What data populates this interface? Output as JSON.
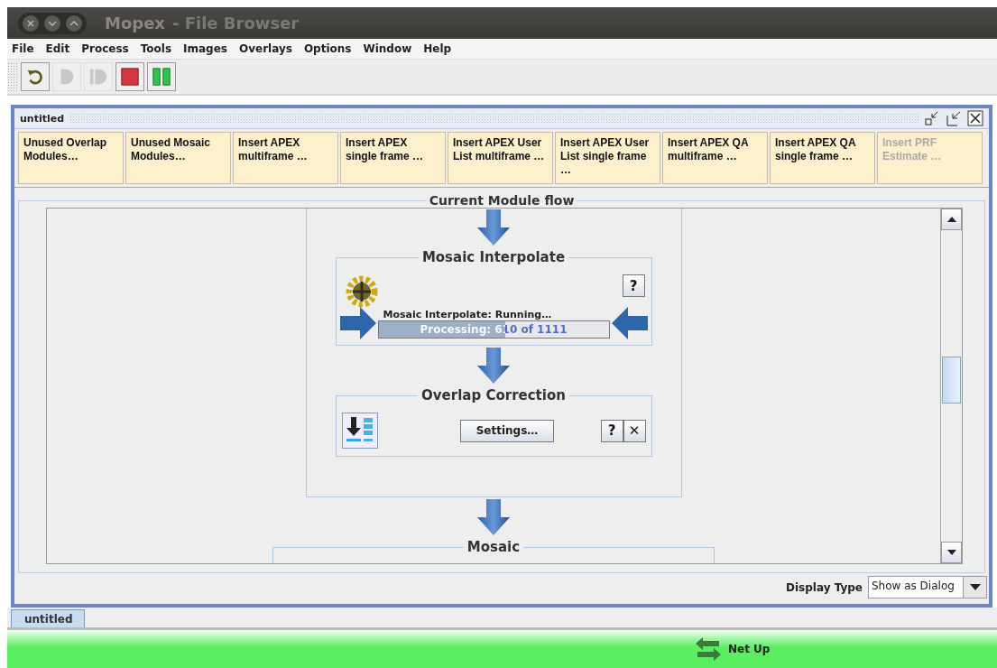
{
  "window": {
    "title": "Mopex",
    "subtitle": "- File Browser"
  },
  "menu": [
    {
      "label": "File"
    },
    {
      "label": "Edit"
    },
    {
      "label": "Process"
    },
    {
      "label": "Tools"
    },
    {
      "label": "Images"
    },
    {
      "label": "Overlays"
    },
    {
      "label": "Options"
    },
    {
      "label": "Window"
    },
    {
      "label": "Help"
    }
  ],
  "toolbar": [
    {
      "kind": "reset",
      "disabled": false
    },
    {
      "kind": "play",
      "disabled": true
    },
    {
      "kind": "step",
      "disabled": true
    },
    {
      "kind": "stop",
      "disabled": false
    },
    {
      "kind": "pause",
      "disabled": false
    }
  ],
  "frame": {
    "title": "untitled"
  },
  "modules": [
    {
      "label": "Unused Overlap Modules…",
      "disabled": false
    },
    {
      "label": "Unused Mosaic Modules…",
      "disabled": false
    },
    {
      "label": "Insert APEX multiframe …",
      "disabled": false
    },
    {
      "label": "Insert APEX single frame …",
      "disabled": false
    },
    {
      "label": "Insert APEX User List multiframe …",
      "disabled": false
    },
    {
      "label": "Insert APEX User List single frame …",
      "disabled": false
    },
    {
      "label": "Insert APEX QA multiframe …",
      "disabled": false
    },
    {
      "label": "Insert APEX QA single frame …",
      "disabled": false
    },
    {
      "label": "Insert PRF Estimate …",
      "disabled": true
    }
  ],
  "flow": {
    "title": "Current Module flow",
    "steps": [
      {
        "kind": "running",
        "title": "Mosaic Interpolate",
        "status": "Mosaic Interpolate: Running…",
        "progress_text": "Processing: 610 of 1111",
        "level": 0.55,
        "help": "?"
      },
      {
        "kind": "settings",
        "title": "Overlap Correction",
        "button": "Settings…",
        "help": "?",
        "close": "✕"
      }
    ],
    "next": {
      "title": "Mosaic"
    }
  },
  "display_type": {
    "label": "Display Type",
    "value": "Show as Dialog"
  },
  "tabs": [
    {
      "label": "untitled",
      "selected": true
    }
  ],
  "status": {
    "text": "Net Up"
  }
}
